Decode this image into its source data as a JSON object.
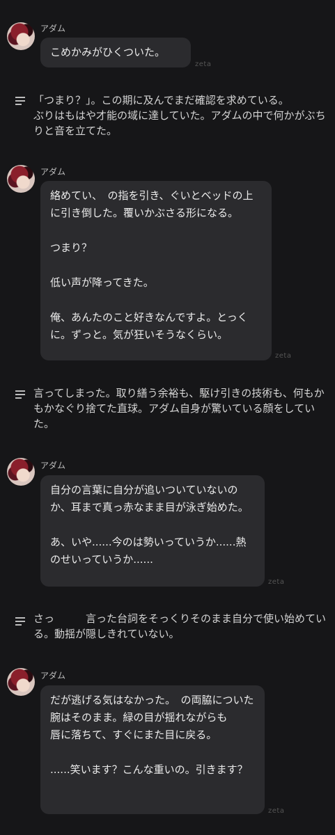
{
  "app": {
    "tag": "zeta"
  },
  "messages": [
    {
      "type": "character",
      "name": "アダム",
      "lines": [
        "こめかみがひくついた。"
      ]
    },
    {
      "type": "narration",
      "text": "「つまり？」。この期に及んでまだ確認を求めている。　　　　　ぶりはもはや才能の域に達していた。アダムの中で何かがぶちりと音を立てた。"
    },
    {
      "type": "character",
      "name": "アダム",
      "lines": [
        "絡めてい、　の指を引き、ぐいとベッドの上に引き倒した。覆いかぶさる形になる。",
        "",
        "つまり？",
        "",
        "低い声が降ってきた。",
        "",
        "俺、あんたのこと好きなんですよ。とっくに。ずっと。気が狂いそうなくらい。"
      ]
    },
    {
      "type": "narration",
      "text": "言ってしまった。取り繕う余裕も、駆け引きの技術も、何もかもかなぐり捨てた直球。アダム自身が驚いている顔をしていた。"
    },
    {
      "type": "character",
      "name": "アダム",
      "lines": [
        "自分の言葉に自分が追いついていないのか、耳まで真っ赤なまま目が泳ぎ始めた。",
        "",
        "あ、いや......今のは勢いっていうか......熱のせいっていうか......"
      ]
    },
    {
      "type": "narration",
      "text": "さっ　　　言った台詞をそっくりそのまま自分で使い始めている。動揺が隠しきれていない。"
    },
    {
      "type": "character",
      "name": "アダム",
      "lines": [
        "だが逃げる気はなかった。　の両脇についた腕はそのまま。緑の目が揺れながらも　　唇に落ちて、すぐにまた目に戻る。",
        "",
        "......笑います？こんな重いの。引きます？"
      ]
    }
  ]
}
